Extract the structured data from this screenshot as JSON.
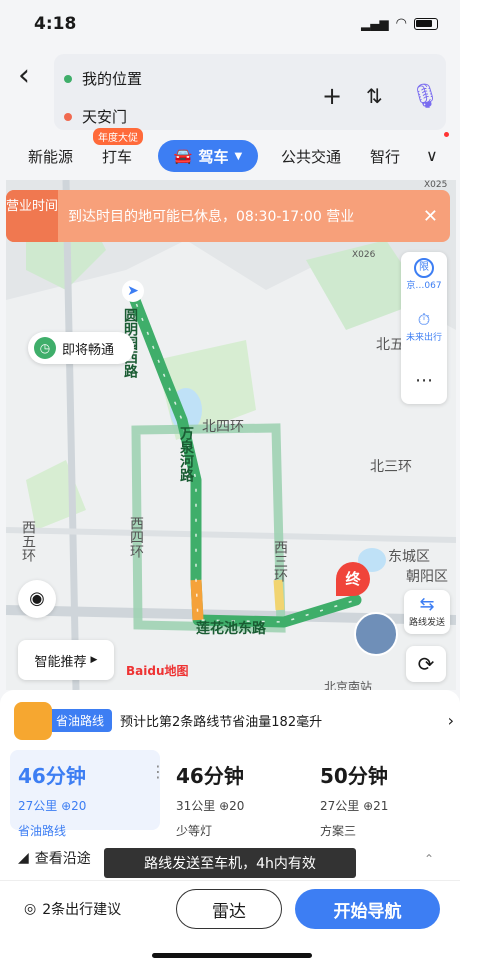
{
  "status": {
    "time": "4:18"
  },
  "search": {
    "from": "我的位置",
    "to": "天安门"
  },
  "tabs": {
    "t1": "新能源",
    "t2": "打车",
    "promo": "年度大促",
    "t3": "驾车",
    "t4": "公共交通",
    "t5": "智行"
  },
  "notice": {
    "tag": "营业时间",
    "message": "到达时目的地可能已休息，08:30-17:00 营业"
  },
  "map": {
    "soon_clear": "即将畅通",
    "smart": "智能推荐",
    "brand": "Baidu地图",
    "end_label": "终",
    "side": {
      "plate": "京…067",
      "future": "未来出行",
      "send": "路线发送"
    },
    "labels": [
      "北四环",
      "北三环",
      "西四环",
      "西五环",
      "西三环",
      "东城区",
      "朝阳区",
      "北五",
      "圆明园西路",
      "万泉河路",
      "莲花池东路",
      "X025",
      "X026",
      "北京南站"
    ]
  },
  "panel": {
    "save_tag": "省油路线",
    "save_msg": "预计比第2条路线节省油量182毫升",
    "options": [
      {
        "time": "46分钟",
        "dist": "27公里",
        "lights": "20",
        "label": "省油路线"
      },
      {
        "time": "46分钟",
        "dist": "31公里",
        "lights": "20",
        "label": "少等灯"
      },
      {
        "time": "50分钟",
        "dist": "27公里",
        "lights": "21",
        "label": "方案三"
      }
    ],
    "along": "查看沿途",
    "toast": "路线发送至车机，4h内有效",
    "suggest": "2条出行建议",
    "radar": "雷达",
    "go": "开始导航"
  },
  "colors": {
    "accent": "#3d7ef3",
    "route": "#3fae6a",
    "notice": "#f07850"
  }
}
